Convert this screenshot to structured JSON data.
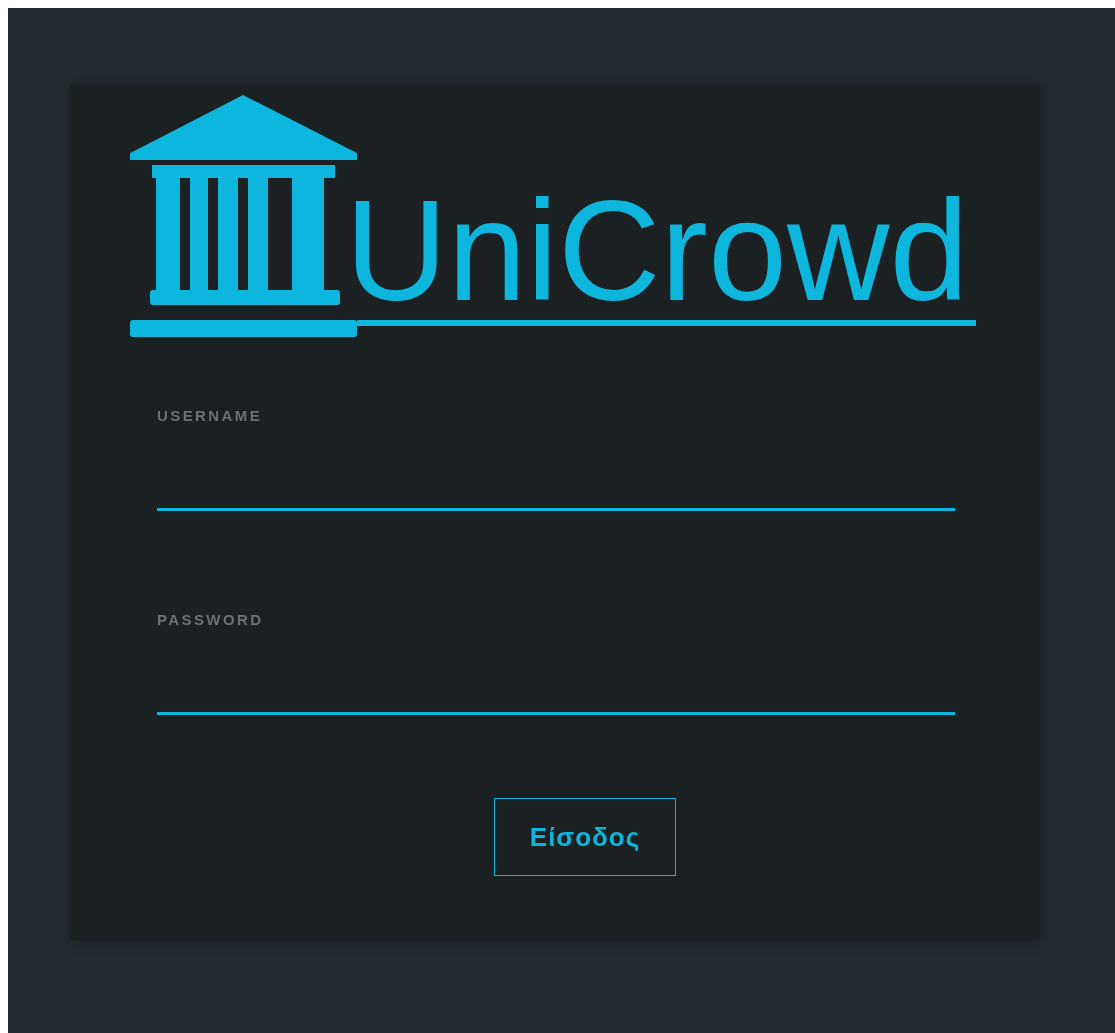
{
  "logo": {
    "text": "UniCrowd"
  },
  "fields": [
    {
      "label": "USERNAME"
    },
    {
      "label": "PASSWORD"
    }
  ],
  "button": {
    "label": "Είσοδος"
  }
}
